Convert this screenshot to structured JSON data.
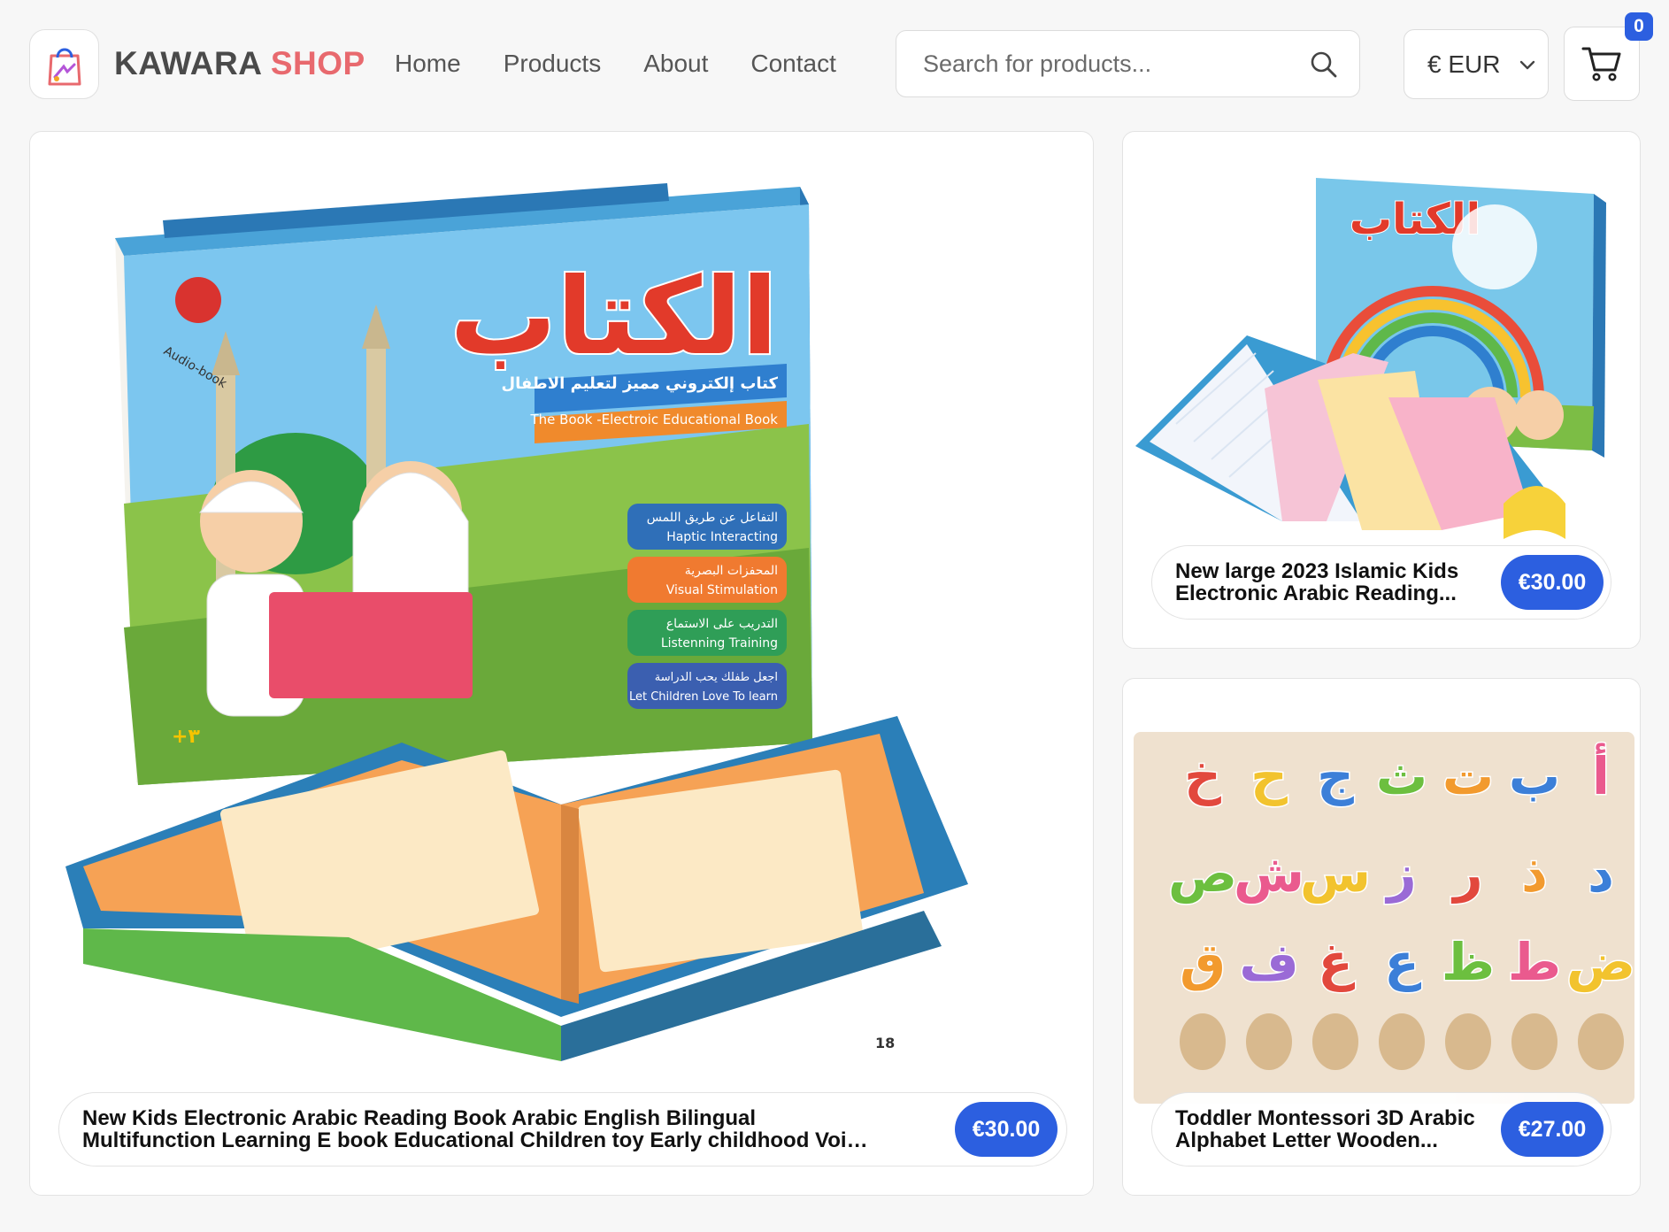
{
  "brand": {
    "name_part1": "KAWARA",
    "name_part2": "SHOP",
    "logo_icon": "shopping-bag-icon"
  },
  "nav": {
    "items": [
      {
        "label": "Home"
      },
      {
        "label": "Products"
      },
      {
        "label": "About"
      },
      {
        "label": "Contact"
      }
    ]
  },
  "search": {
    "placeholder": "Search for products...",
    "value": "",
    "icon": "search-icon"
  },
  "currency": {
    "selected": "€ EUR",
    "icon": "chevron-down-icon"
  },
  "cart": {
    "count": "0",
    "icon": "cart-icon"
  },
  "colors": {
    "accent": "#2c5fe0",
    "brand_red": "#e8696e",
    "brand_gray": "#4a4a4a"
  },
  "products": [
    {
      "title": "New Kids Electronic Arabic Reading Book Arabic English Bilingual Multifunction Learning E book Educational Children toy Early childhood Voice Learning Game...",
      "price": "€30.00",
      "image_box": {
        "arabic_title": "الكتاب",
        "arabic_subtitle": "كتاب إلكتروني مميز لتعليم الاطفال",
        "english_subtitle": "The Book -Electroic Educational Book",
        "audio_label": "Audio-book",
        "features": [
          {
            "ar": "التفاعل عن طريق اللمس",
            "en": "Haptic Interacting"
          },
          {
            "ar": "المحفزات البصرية",
            "en": "Visual Stimulation"
          },
          {
            "ar": "التدريب على الاستماع",
            "en": "Listenning Training"
          },
          {
            "ar": "اجعل طفلك يحب الدراسة",
            "en": "Let Children Love To learn"
          }
        ],
        "age_badge": "+٣",
        "page_number": "18"
      }
    },
    {
      "title": "New large 2023 Islamic Kids Electronic Arabic Reading...",
      "price": "€30.00",
      "image_box": {
        "arabic_title": "الكتاب"
      }
    },
    {
      "title": "Toddler Montessori 3D Arabic Alphabet Letter Wooden...",
      "price": "€27.00",
      "image_box": {
        "letters_row1": [
          "أ",
          "ب",
          "ت",
          "ث",
          "ج",
          "ح",
          "خ"
        ],
        "letters_row2": [
          "د",
          "ذ",
          "ر",
          "ز",
          "س",
          "ش",
          "ص"
        ],
        "letters_row3": [
          "ض",
          "ط",
          "ظ",
          "ع",
          "غ",
          "ف",
          "ق"
        ]
      }
    }
  ]
}
